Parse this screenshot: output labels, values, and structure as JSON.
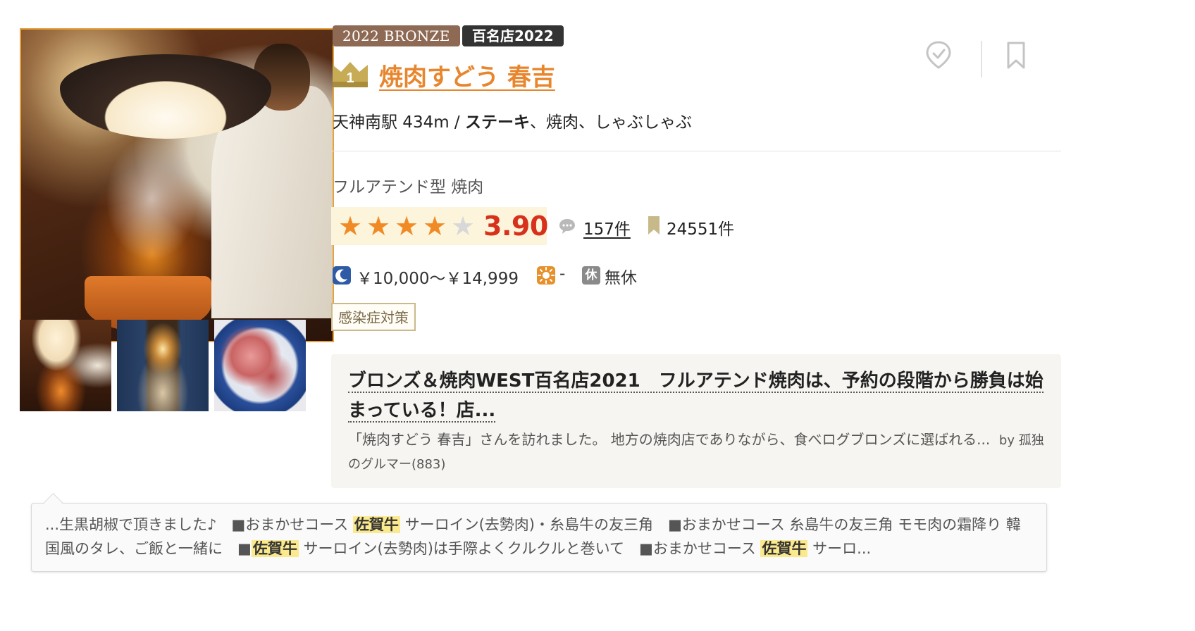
{
  "badges": {
    "award": "2022 BRONZE",
    "hyakumeiten": "百名店2022"
  },
  "restaurant": {
    "rank": "1",
    "name": "焼肉すどう 春吉",
    "station_distance": "天神南駅 434m",
    "separator": " / ",
    "main_genre": "ステーキ",
    "other_genres": "、焼肉、しゃぶしゃぶ",
    "subtitle": "フルアテンド型 焼肉"
  },
  "rating": {
    "score": "3.90",
    "stars_value": 3.9,
    "stars_max": 5,
    "review_count": "157件",
    "save_count": "24551件"
  },
  "prices": {
    "dinner": "￥10,000～￥14,999",
    "lunch": "-",
    "holiday_icon_label": "休",
    "holiday": "無休"
  },
  "tags": {
    "covid": "感染症対策"
  },
  "review": {
    "title": "ブロンズ＆焼肉WEST百名店2021　フルアテンド焼肉は、予約の段階から勝負は始まっている！店...",
    "body": "「焼肉すどう 春吉」さんを訪れました。 地方の焼肉店でありながら、食べログブロンズに選ばれる...",
    "author": "by 孤独のグルマー(883)"
  },
  "snippet": {
    "part1": "...生黒胡椒で頂きました♪　■おまかせコース ",
    "hl1": "佐賀牛",
    "part2": " サーロイン(去勢肉)・糸島牛の友三角　■おまかせコース 糸島牛の友三角 モモ肉の霜降り 韓国風のタレ、ご飯と一緒に　■",
    "hl2": "佐賀牛",
    "part3": " サーロイン(去勢肉)は手際よくクルクルと巻いて　■おまかせコース ",
    "hl3": "佐賀牛",
    "part4": " サーロ..."
  },
  "colors": {
    "title": "#e8862e",
    "score": "#d7311b",
    "star_on": "#f08a24",
    "star_off": "#d8d8d8",
    "bronze_badge": "#8e6a55",
    "highlight": "#fbe98e"
  },
  "icons": {
    "crown": "crown-icon",
    "visited": "visited-check-icon",
    "bookmark": "bookmark-icon",
    "comment": "comment-bubble-icon",
    "save": "save-bookmark-icon",
    "dinner": "moon-icon",
    "lunch": "sun-icon"
  }
}
